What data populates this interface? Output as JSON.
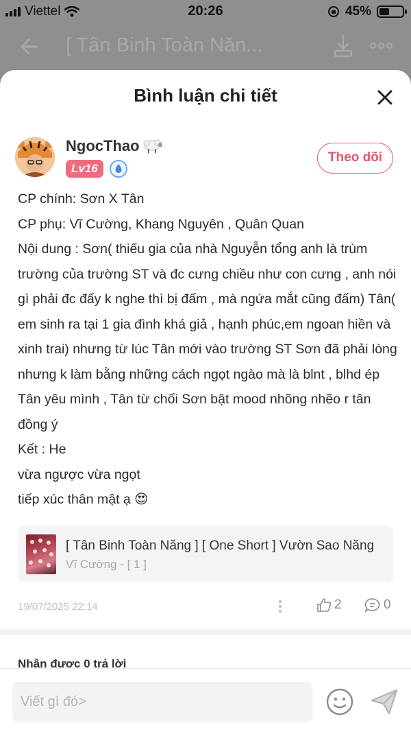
{
  "status_bar": {
    "carrier": "Viettel",
    "time": "20:26",
    "battery": "45%",
    "battery_level": 0.45
  },
  "nav": {
    "title": "[ Tân Binh Toàn Năn..."
  },
  "sheet": {
    "title": "Bình luận chi tiết"
  },
  "comment": {
    "username": "NgocThao",
    "level": "Lv16",
    "follow_label": "Theo dõi",
    "lines": [
      "CP chính: Sơn X Tân",
      "CP phụ: Vĩ Cường, Khang Nguyên , Quân Quan",
      "Nội dung : Sơn( thiếu gia của nhà Nguyễn tổng anh là trùm trường của trường ST và đc cưng chiều như con cưng , anh nói gì phải đc đấy k nghe thì bị đấm , mà ngứa mắt cũng đấm) Tân( em sinh ra tại 1 gia đình khá giả , hạnh phúc,em ngoan hiền và xinh trai) nhưng từ lúc Tân mới vào trường ST Sơn đã phải lòng nhưng k làm bằng những cách ngọt ngào mà là blnt , blhd ép Tân yêu mình , Tân từ chối Sơn bật mood nhõng nhẽo r tân đồng ý",
      "Kết : He",
      "vừa ngược vừa ngọt",
      "tiếp xúc thân mật ạ 😍"
    ],
    "date": "19/07/2025 22:14",
    "likes": "2",
    "comments": "0"
  },
  "story": {
    "title": "[ Tân Binh Toàn Năng ] [ One Short ] Vườn Sao Năng",
    "subtitle": "Vĩ Cường - [ 1 ]"
  },
  "replies_label": "Nhận được 0 trả lời",
  "input": {
    "placeholder": "Viết gì đó>"
  },
  "colors": {
    "accent": "#e8566c",
    "level_badge": "#f06b7d",
    "overlay": "#8f8f8f"
  }
}
